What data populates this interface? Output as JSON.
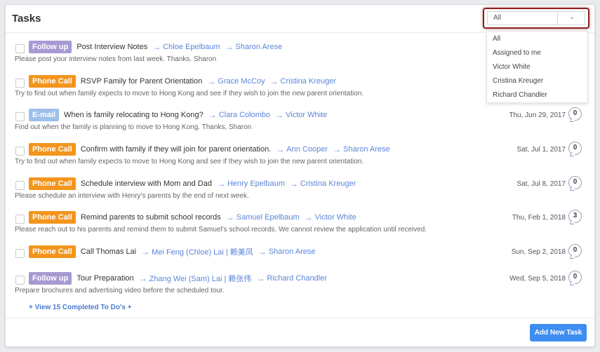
{
  "header": {
    "title": "Tasks"
  },
  "filter": {
    "selected": "All",
    "options": [
      "All",
      "Assigned to me",
      "Victor White",
      "Cristina Kreuger",
      "Richard Chandler"
    ]
  },
  "colors": {
    "follow_up": "#a79ad3",
    "phone_call": "#f3951d",
    "email": "#9dc0ea",
    "link": "#5b85d9",
    "primary": "#3d8ef0",
    "highlight": "#8b1f1f"
  },
  "tasks": [
    {
      "type": "Follow up",
      "title": "Post Interview Notes",
      "from": "Chloe Epelbaum",
      "to": "Sharon Arese",
      "description": "Please post your interview notes from last week. Thanks. Sharon",
      "due": "",
      "comments": ""
    },
    {
      "type": "Phone Call",
      "title": "RSVP Family for Parent Orientation",
      "from": "Grace McCoy",
      "to": "Cristina Kreuger",
      "description": "Try to find out when family expects to move to Hong Kong and see if they wish to join the new parent orientation.",
      "due": "",
      "comments": ""
    },
    {
      "type": "E-mail",
      "title": "When is family relocating to Hong Kong?",
      "from": "Clara Colombo",
      "to": "Victor White",
      "description": "Find out when the family is planning to move to Hong Kong. Thanks, Sharon",
      "due": "Thu, Jun 29, 2017",
      "comments": "0"
    },
    {
      "type": "Phone Call",
      "title": "Confirm with family if they will join for parent orientation.",
      "from": "Ann Cooper",
      "to": "Sharon Arese",
      "description": "Try to find out when family expects to move to Hong Kong and see if they wish to join the new parent orientation.",
      "due": "Sat, Jul 1, 2017",
      "comments": "0"
    },
    {
      "type": "Phone Call",
      "title": "Schedule interview with Mom and Dad",
      "from": "Henry Epelbaum",
      "to": "Cristina Kreuger",
      "description": "Please schedule an interview with Henry's parents by the end of next week.",
      "due": "Sat, Jul 8, 2017",
      "comments": "0"
    },
    {
      "type": "Phone Call",
      "title": "Remind parents to submit school records",
      "from": "Samuel Epelbaum",
      "to": "Victor White",
      "description": "Please reach out to his parents and remind them to submit Samuel's school records. We cannot review the application until received.",
      "due": "Thu, Feb 1, 2018",
      "comments": "3"
    },
    {
      "type": "Phone Call",
      "title": "Call Thomas Lai",
      "from": "Mei Feng (Chloe) Lai | 赖美凤",
      "to": "Sharon Arese",
      "description": "",
      "due": "Sun, Sep 2, 2018",
      "comments": "0"
    },
    {
      "type": "Follow up",
      "title": "Tour Preparation",
      "from": "Zhang Wei (Sam) Lai | 赖张伟",
      "to": "Richard Chandler",
      "description": "Prepare brochures and advertising video before the scheduled tour.",
      "due": "Wed, Sep 5, 2018",
      "comments": "0"
    }
  ],
  "arrow_glyph": "→",
  "view_completed": "+ View 15 Completed To Do's +",
  "add_button": "Add New Task"
}
